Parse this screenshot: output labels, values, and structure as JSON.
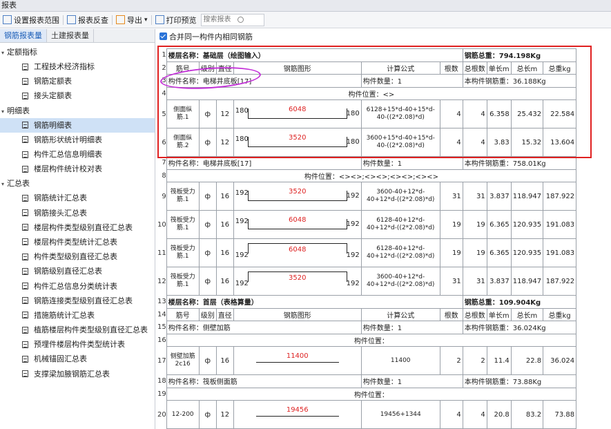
{
  "window": {
    "title": "报表"
  },
  "toolbar": {
    "set_range": "设置报表范围",
    "check": "报表反查",
    "export": "导出",
    "export_caret": "▾",
    "print_preview": "打印预览",
    "search_placeholder": "搜索报表"
  },
  "left_tabs": {
    "rebar": "钢筋报表量",
    "civil": "土建报表量"
  },
  "tree": {
    "g1": "定额指标",
    "g1_items": [
      "工程技术经济指标",
      "钢筋定额表",
      "接头定额表"
    ],
    "g2": "明细表",
    "g2_items": [
      "钢筋明细表",
      "钢筋形状统计明细表",
      "构件汇总信息明细表",
      "楼层构件统计校对表"
    ],
    "g3": "汇总表",
    "g3_items": [
      "钢筋统计汇总表",
      "钢筋接头汇总表",
      "楼层构件类型级别直径汇总表",
      "楼层构件类型统计汇总表",
      "构件类型级别直径汇总表",
      "钢筋级别直径汇总表",
      "构件汇总信息分类统计表",
      "钢筋连接类型级别直径汇总表",
      "措施筋统计汇总表",
      "植筋楼层构件类型级别直径汇总表",
      "预埋件楼层构件类型统计表",
      "机械锚固汇总表",
      "支撑梁加腋钢筋汇总表"
    ]
  },
  "option": {
    "merge": "合并同一构件内相同钢筋"
  },
  "table": {
    "rownums": [
      "1",
      "2",
      "3",
      "4",
      "5",
      "6",
      "7",
      "8",
      "9",
      "10",
      "11",
      "12",
      "13",
      "14",
      "15",
      "16",
      "17",
      "18",
      "19",
      "20"
    ],
    "floor1": {
      "name": "楼层名称：基础层（绘图输入）",
      "total": "钢筋总重：794.198Kg"
    },
    "headers": [
      "筋号",
      "级别",
      "直径",
      "钢筋图形",
      "计算公式",
      "根数",
      "总根数",
      "单长m",
      "总长m",
      "总重kg"
    ],
    "comp1": {
      "name": "构件名称：电梯井底板[17]",
      "count": "构件数量：1",
      "weight": "本构件钢筋重：36.188Kg",
      "pos": "构件位置：<>"
    },
    "comp1_rows": [
      {
        "id": "侧面纵筋.1",
        "grade": "ф",
        "dia": "12",
        "l": "180",
        "len": "6048",
        "r": "180",
        "formula": "6128+15*d-40+15*d-40-((2*2.08)*d)",
        "n": "4",
        "tn": "4",
        "ul": "6.358",
        "tl": "25.432",
        "tw": "22.584"
      },
      {
        "id": "侧面纵筋.2",
        "grade": "ф",
        "dia": "12",
        "l": "180",
        "len": "3520",
        "r": "180",
        "formula": "3600+15*d-40+15*d-40-((2*2.08)*d)",
        "n": "4",
        "tn": "4",
        "ul": "3.83",
        "tl": "15.32",
        "tw": "13.604"
      }
    ],
    "comp2": {
      "name": "构件名称：电梯井底板[17]",
      "count": "构件数量：1",
      "weight": "本构件钢筋重：758.01Kg",
      "pos": "构件位置：<><>;<><>;<><>;<><>"
    },
    "comp2_rows": [
      {
        "id": "筏板受力筋.1",
        "grade": "ф",
        "dia": "16",
        "l": "192",
        "len": "3520",
        "r": "192",
        "formula": "3600-40+12*d-40+12*d-((2*2.08)*d)",
        "n": "31",
        "tn": "31",
        "ul": "3.837",
        "tl": "118.947",
        "tw": "187.922"
      },
      {
        "id": "筏板受力筋.1",
        "grade": "ф",
        "dia": "16",
        "l": "192",
        "len": "6048",
        "r": "192",
        "formula": "6128-40+12*d-40+12*d-((2*2.08)*d)",
        "n": "19",
        "tn": "19",
        "ul": "6.365",
        "tl": "120.935",
        "tw": "191.083"
      },
      {
        "id": "筏板受力筋.1",
        "grade": "ф",
        "dia": "16",
        "l": "192",
        "len": "6048",
        "r": "192",
        "formula": "6128-40+12*d-40+12*d-((2*2.08)*d)",
        "n": "19",
        "tn": "19",
        "ul": "6.365",
        "tl": "120.935",
        "tw": "191.083"
      },
      {
        "id": "筏板受力筋.1",
        "grade": "ф",
        "dia": "16",
        "l": "192",
        "len": "3520",
        "r": "192",
        "formula": "3600-40+12*d-40+12*d-((2*2.08)*d)",
        "n": "31",
        "tn": "31",
        "ul": "3.837",
        "tl": "118.947",
        "tw": "187.922"
      }
    ],
    "floor2": {
      "name": "楼层名称：首层（表格算量）",
      "total": "钢筋总重：109.904Kg"
    },
    "comp3": {
      "name": "构件名称：侧壁加筋",
      "count": "构件数量：1",
      "weight": "本构件钢筋重：36.024Kg",
      "pos": "构件位置："
    },
    "comp3_row": {
      "id": "侧壁加筋2c16",
      "grade": "ф",
      "dia": "16",
      "len": "11400",
      "formula": "11400",
      "n": "2",
      "tn": "2",
      "ul": "11.4",
      "tl": "22.8",
      "tw": "36.024"
    },
    "comp4": {
      "name": "构件名称：筏板侧面筋",
      "count": "构件数量：1",
      "weight": "本构件钢筋重：73.88Kg",
      "pos": "构件位置："
    },
    "comp4_row": {
      "id": "12-200",
      "grade": "ф",
      "dia": "12",
      "len": "19456",
      "formula": "19456+1344",
      "n": "4",
      "tn": "4",
      "ul": "20.8",
      "tl": "83.2",
      "tw": "73.88"
    }
  },
  "colors": {
    "highlight_box": "#e02020",
    "ellipse": "#c330d8",
    "shape_length": "#d22222",
    "selected": "#cfe1f6"
  }
}
